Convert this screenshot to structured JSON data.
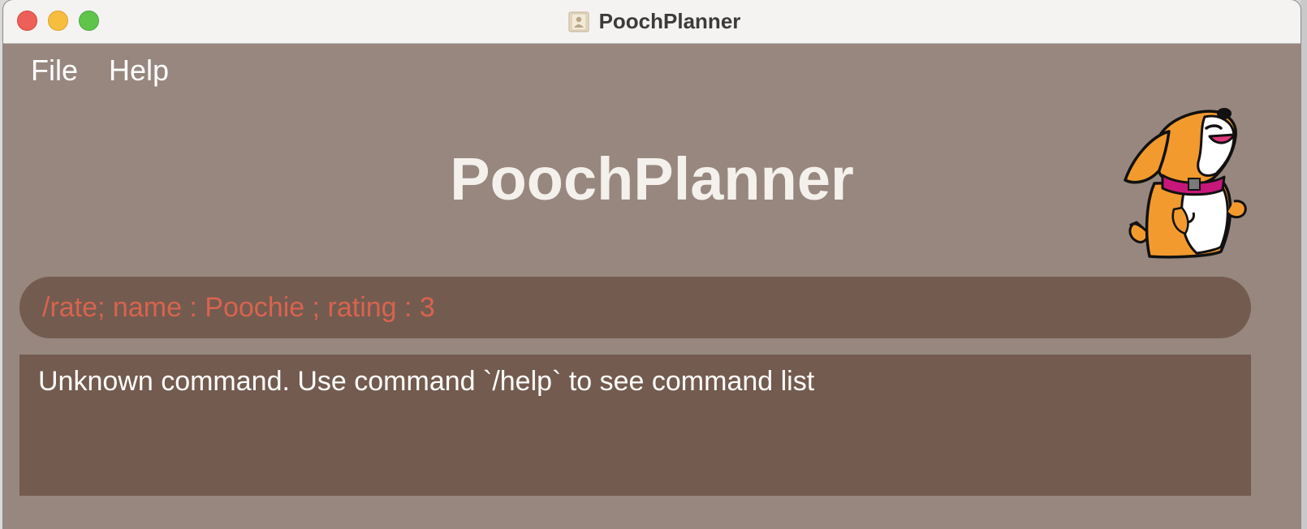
{
  "window": {
    "title": "PoochPlanner",
    "controls": [
      "close",
      "minimize",
      "maximize"
    ],
    "title_icon": "app-icon"
  },
  "menu": {
    "items": [
      {
        "label": "File"
      },
      {
        "label": "Help"
      }
    ]
  },
  "header": {
    "app_title": "PoochPlanner",
    "mascot": "dog-mascot"
  },
  "command": {
    "value": "/rate; name : Poochie ; rating : 3",
    "text_color": "#d9634f"
  },
  "result": {
    "message": "Unknown command. Use command `/help` to see command list"
  },
  "colors": {
    "background": "#97877e",
    "panel": "#735b4f",
    "title_text": "#f4f0ec"
  }
}
